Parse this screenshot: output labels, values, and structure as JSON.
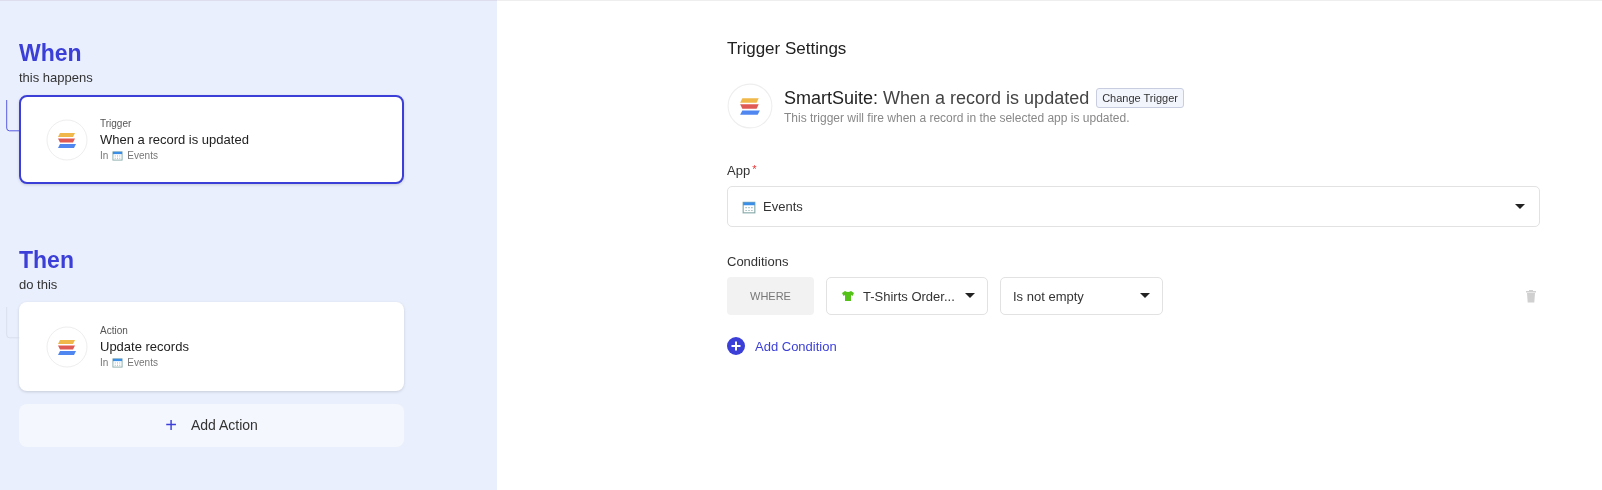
{
  "steps": [
    {
      "heading": "When",
      "subheading": "this happens",
      "card": {
        "type": "Trigger",
        "title": "When a record is updated",
        "in": "In",
        "app": "Events",
        "selected": true
      }
    },
    {
      "heading": "Then",
      "subheading": "do this",
      "card": {
        "type": "Action",
        "title": "Update records",
        "in": "In",
        "app": "Events",
        "selected": false
      }
    }
  ],
  "add_action": {
    "icon": "+",
    "label": "Add Action"
  },
  "settings": {
    "title": "Trigger Settings",
    "integration": "SmartSuite:",
    "event": "When a record is updated",
    "change_button": "Change Trigger",
    "description": "This trigger will fire when a record in the selected app is updated.",
    "app_field": {
      "label": "App",
      "required": true,
      "required_mark": "*",
      "value": "Events"
    },
    "conditions_label": "Conditions",
    "conditions": [
      {
        "where": "WHERE",
        "field": "T-Shirts Order...",
        "operator": "Is not empty"
      }
    ],
    "add_condition": "Add Condition"
  }
}
